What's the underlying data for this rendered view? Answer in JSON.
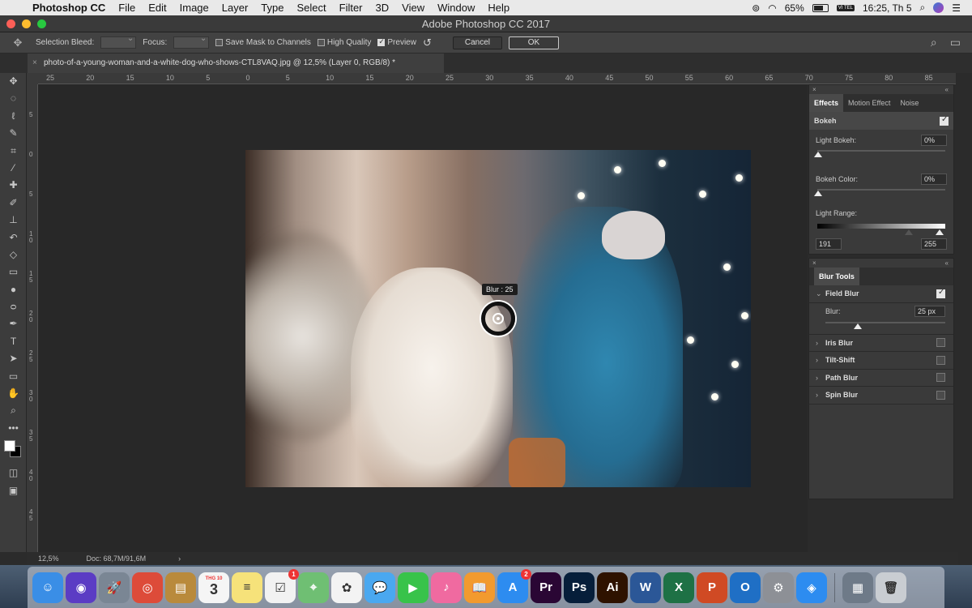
{
  "menubar": {
    "app": "Photoshop CC",
    "items": [
      "File",
      "Edit",
      "Image",
      "Layer",
      "Type",
      "Select",
      "Filter",
      "3D",
      "View",
      "Window",
      "Help"
    ],
    "battery": "65%",
    "input_source": "VI TEL",
    "clock": "16:25, Th 5"
  },
  "window": {
    "title": "Adobe Photoshop CC 2017"
  },
  "options": {
    "selection_bleed_label": "Selection Bleed:",
    "focus_label": "Focus:",
    "save_mask_label": "Save Mask to Channels",
    "save_mask_checked": false,
    "high_quality_label": "High Quality",
    "high_quality_checked": false,
    "preview_label": "Preview",
    "preview_checked": true,
    "cancel_label": "Cancel",
    "ok_label": "OK"
  },
  "document": {
    "tab_title": "photo-of-a-young-woman-and-a-white-dog-who-shows-CTL8VAQ.jpg @ 12,5% (Layer 0, RGB/8) *"
  },
  "ruler": {
    "h_ticks": [
      "25",
      "20",
      "15",
      "10",
      "5",
      "0",
      "5",
      "10",
      "15",
      "20",
      "25",
      "30",
      "35",
      "40",
      "45",
      "50",
      "55",
      "60",
      "65",
      "70",
      "75",
      "80",
      "85"
    ],
    "v_ticks": [
      "5",
      "0",
      "5",
      "1 0",
      "1 5",
      "2 0",
      "2 5",
      "3 0",
      "3 5",
      "4 0",
      "4 5"
    ]
  },
  "canvas": {
    "pin_label": "Blur : 25"
  },
  "effects_panel": {
    "tabs": [
      "Effects",
      "Motion Effect",
      "Noise"
    ],
    "active_tab": "Effects",
    "bokeh_label": "Bokeh",
    "bokeh_checked": true,
    "light_bokeh_label": "Light Bokeh:",
    "light_bokeh_value": "0%",
    "bokeh_color_label": "Bokeh Color:",
    "bokeh_color_value": "0%",
    "light_range_label": "Light Range:",
    "light_range_low": "191",
    "light_range_high": "255"
  },
  "blur_tools": {
    "title": "Blur Tools",
    "field_blur_label": "Field Blur",
    "field_blur_checked": true,
    "blur_label": "Blur:",
    "blur_value": "25 px",
    "items": [
      {
        "label": "Iris Blur",
        "checked": false
      },
      {
        "label": "Tilt-Shift",
        "checked": false
      },
      {
        "label": "Path Blur",
        "checked": false
      },
      {
        "label": "Spin Blur",
        "checked": false
      }
    ]
  },
  "status": {
    "zoom": "12,5%",
    "doc_size": "Doc: 68,7M/91,6M",
    "arrow": "›"
  },
  "dock": {
    "calendar_month": "THG 10",
    "calendar_day": "3",
    "reminders_badge": "1",
    "appstore_badge": "2",
    "apps": [
      {
        "name": "Finder",
        "label": "☺",
        "color": "#3a8ee6"
      },
      {
        "name": "Siri",
        "label": "◉",
        "color": "#5b3cc4"
      },
      {
        "name": "Launchpad",
        "label": "🚀",
        "color": "#7a8694"
      },
      {
        "name": "Chrome",
        "label": "◎",
        "color": "#dd4b39"
      },
      {
        "name": "Notes-book",
        "label": "▤",
        "color": "#b98a3c"
      },
      {
        "name": "Calendar",
        "label": "3",
        "color": "#f5f5f5"
      },
      {
        "name": "Notes",
        "label": "≡",
        "color": "#f6e27a"
      },
      {
        "name": "Reminders",
        "label": "☑",
        "color": "#f2f2f2"
      },
      {
        "name": "Maps",
        "label": "⌖",
        "color": "#6fbf73"
      },
      {
        "name": "Photos",
        "label": "✿",
        "color": "#f3f3f3"
      },
      {
        "name": "Messages",
        "label": "💬",
        "color": "#4aa8f0"
      },
      {
        "name": "FaceTime",
        "label": "▶",
        "color": "#38c34a"
      },
      {
        "name": "iTunes",
        "label": "♪",
        "color": "#f06aa0"
      },
      {
        "name": "iBooks",
        "label": "📖",
        "color": "#f29a2e"
      },
      {
        "name": "App Store",
        "label": "A",
        "color": "#2d8cf0"
      },
      {
        "name": "Premiere",
        "label": "Pr",
        "color": "#2a0634"
      },
      {
        "name": "Photoshop",
        "label": "Ps",
        "color": "#061e3a"
      },
      {
        "name": "Illustrator",
        "label": "Ai",
        "color": "#2e1200"
      },
      {
        "name": "Word",
        "label": "W",
        "color": "#2b5797"
      },
      {
        "name": "Excel",
        "label": "X",
        "color": "#1e7145"
      },
      {
        "name": "PowerPoint",
        "label": "P",
        "color": "#d04a24"
      },
      {
        "name": "Outlook",
        "label": "O",
        "color": "#1f6fc5"
      },
      {
        "name": "System Preferences",
        "label": "⚙",
        "color": "#8d9096"
      },
      {
        "name": "Safari",
        "label": "◈",
        "color": "#2d8cf0"
      },
      {
        "name": "Downloads",
        "label": "▦",
        "color": "#6e7a88"
      },
      {
        "name": "Trash",
        "label": "🗑",
        "color": "#c9cdd2"
      }
    ]
  }
}
